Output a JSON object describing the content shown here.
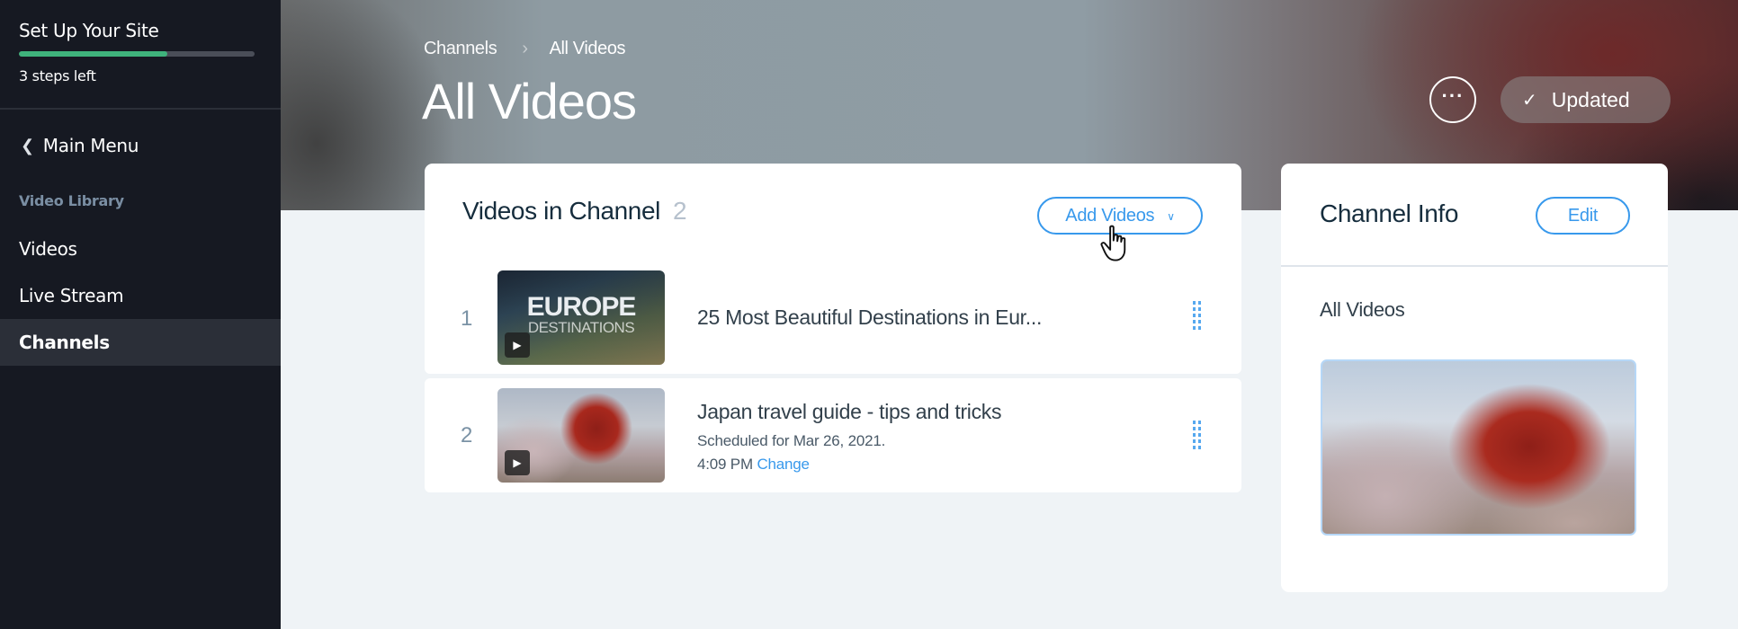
{
  "sidebar": {
    "setup_title": "Set Up Your Site",
    "progress_fraction": 0.63,
    "steps_left": "3 steps left",
    "main_menu": "Main Menu",
    "section_label": "Video Library",
    "items": [
      {
        "label": "Videos",
        "active": false
      },
      {
        "label": "Live Stream",
        "active": false
      },
      {
        "label": "Channels",
        "active": true
      }
    ],
    "colors": {
      "progress": "#3fb37c",
      "background": "#161922",
      "active_bg": "#2b2f38"
    }
  },
  "header": {
    "breadcrumb": [
      "Channels",
      "All Videos"
    ],
    "title": "All Videos",
    "more_icon": "ellipsis-icon",
    "updated_label": "Updated",
    "updated_icon": "check-icon"
  },
  "videos_card": {
    "title": "Videos in Channel",
    "count": "2",
    "add_button": "Add Videos",
    "videos": [
      {
        "index": "1",
        "title": "25 Most Beautiful Destinations in Eur...",
        "thumb_text_main": "EUROPE",
        "thumb_text_sub": "DESTINATIONS"
      },
      {
        "index": "2",
        "title": "Japan travel guide - tips and tricks",
        "scheduled": "Scheduled for Mar 26, 2021.",
        "time": "4:09 PM",
        "change_link": "Change"
      }
    ]
  },
  "info_card": {
    "title": "Channel Info",
    "edit_button": "Edit",
    "channel_name": "All Videos"
  },
  "accent_color": "#3899ec"
}
